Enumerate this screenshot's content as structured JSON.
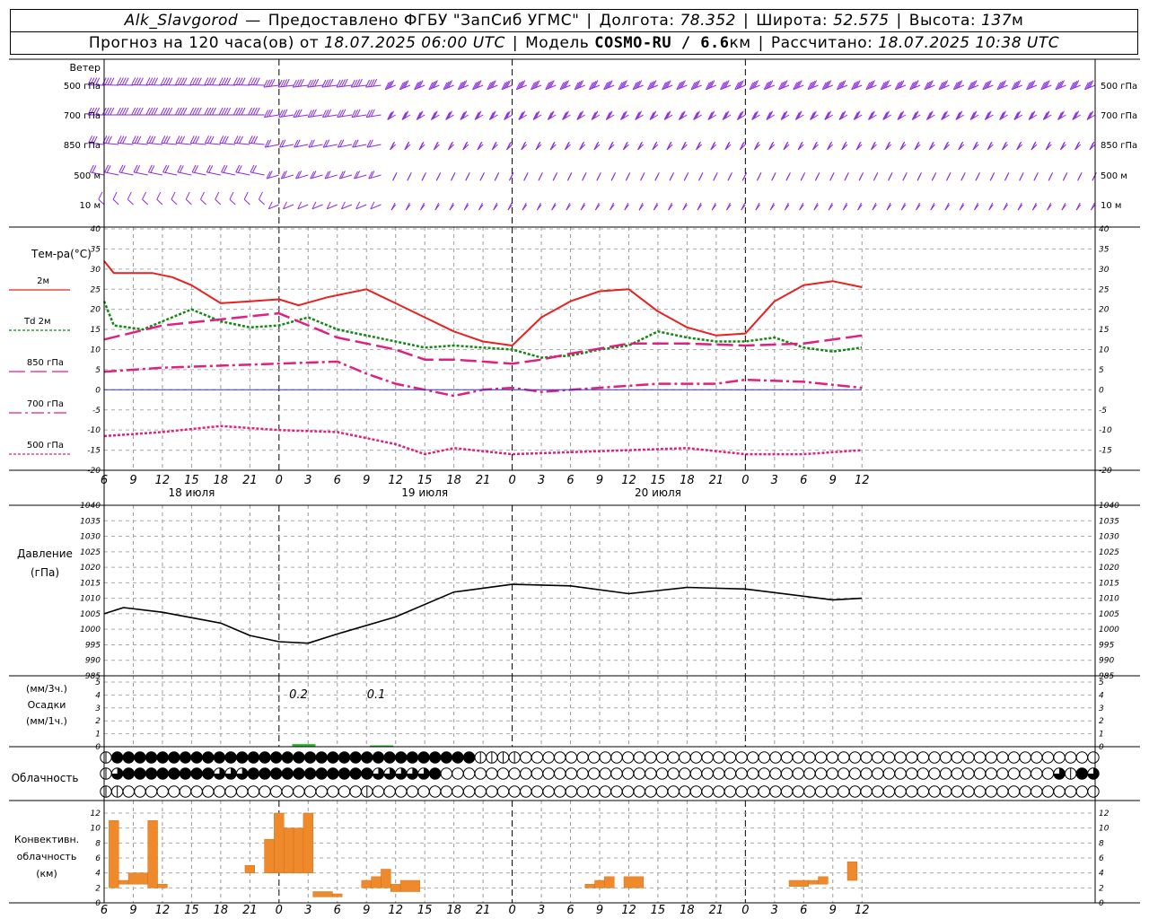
{
  "header": {
    "station": "Alk_Slavgorod",
    "provider": "Предоставлено ФГБУ \"ЗапСиб УГМС\"",
    "lon_label": "Долгота:",
    "lon": "78.352",
    "lat_label": "Широта:",
    "lat": "52.575",
    "alt_label": "Высота:",
    "alt": "137",
    "alt_unit": "м",
    "forecast_prefix": "Прогноз на 120 часа(ов) от",
    "forecast_time": "18.07.2025 06:00 UTC",
    "model_prefix": "Модель",
    "model": "COSMO-RU / 6.6",
    "model_unit": "км",
    "calc_prefix": "Рассчитано:",
    "calc_time": "18.07.2025 10:38 UTC"
  },
  "labels": {
    "wind": "Ветер",
    "wind_levels": [
      "500 гПа",
      "700 гПа",
      "850 гПа",
      "500 м",
      "10 м"
    ],
    "temp_title": "Тем-ра(°C)",
    "pressure_title": "Давление",
    "pressure_unit": "(гПа)",
    "precip_unit_top": "(мм/3ч.)",
    "precip_title": "Осадки",
    "precip_unit_bottom": "(мм/1ч.)",
    "cloud_title": "Облачность",
    "conv_title_1": "Конвективн.",
    "conv_title_2": "облачность",
    "conv_unit": "(км)"
  },
  "chart_data": {
    "type": "line",
    "time_axis": {
      "start": "18.07.2025 06:00 UTC",
      "tick_labels": [
        "6",
        "9",
        "12",
        "15",
        "18",
        "21",
        "0",
        "3",
        "6",
        "9",
        "12",
        "15",
        "18",
        "21",
        "0",
        "3",
        "6",
        "9",
        "12",
        "15",
        "18",
        "21",
        "0",
        "3",
        "6",
        "9",
        "12"
      ],
      "day_labels": [
        "18 июля",
        "19 июля",
        "20 июля"
      ]
    },
    "temperature": {
      "ylim": [
        -20,
        40
      ],
      "ticks": [
        40,
        35,
        30,
        25,
        20,
        15,
        10,
        5,
        0,
        -5,
        -10,
        -15,
        -20
      ],
      "series": [
        {
          "name": "2м",
          "color": "#e82020",
          "x": [
            "18.07 06:00",
            "18.07 07:00",
            "18.07 09:00",
            "18.07 11:00",
            "18.07 13:00",
            "18.07 15:00",
            "18.07 18:00",
            "18.07 21:00",
            "19.07 00:00",
            "19.07 02:00",
            "19.07 05:00",
            "19.07 09:00",
            "19.07 12:00",
            "19.07 15:00",
            "19.07 18:00",
            "19.07 21:00",
            "20.07 00:00",
            "20.07 03:00",
            "20.07 06:00",
            "20.07 09:00",
            "20.07 12:00",
            "20.07 15:00",
            "20.07 18:00",
            "20.07 21:00",
            "21.07 00:00",
            "21.07 03:00",
            "21.07 06:00",
            "21.07 09:00",
            "21.07 12:00"
          ],
          "y": [
            32,
            29,
            29,
            29,
            28,
            26,
            21.5,
            22,
            22.5,
            21,
            23,
            25,
            21.5,
            18,
            14.5,
            12,
            11,
            18,
            22,
            24.5,
            25,
            19.5,
            15.5,
            13.5,
            14,
            22,
            26,
            27,
            25.5
          ]
        },
        {
          "name": "Td 2м",
          "color": "#118811",
          "x": [
            "18.07 06:00",
            "18.07 07:00",
            "18.07 10:00",
            "18.07 12:00",
            "18.07 15:00",
            "18.07 18:00",
            "18.07 21:00",
            "19.07 00:00",
            "19.07 03:00",
            "19.07 06:00",
            "19.07 09:00",
            "19.07 12:00",
            "19.07 15:00",
            "19.07 18:00",
            "19.07 21:00",
            "20.07 00:00",
            "20.07 03:00",
            "20.07 06:00",
            "20.07 09:00",
            "20.07 12:00",
            "20.07 15:00",
            "20.07 18:00",
            "20.07 21:00",
            "21.07 00:00",
            "21.07 03:00",
            "21.07 06:00",
            "21.07 09:00",
            "21.07 12:00"
          ],
          "y": [
            22,
            16,
            15,
            17,
            20,
            17,
            15.5,
            16,
            18,
            15,
            13.5,
            12,
            10.5,
            11,
            10.5,
            10,
            8,
            8.5,
            10,
            11,
            14.5,
            13,
            12,
            12,
            13,
            10.5,
            9.5,
            10.5
          ]
        },
        {
          "name": "850 гПа",
          "color": "#e0207f",
          "x": [
            "18.07 06:00",
            "18.07 12:00",
            "18.07 18:00",
            "19.07 00:00",
            "19.07 06:00",
            "19.07 12:00",
            "19.07 15:00",
            "19.07 18:00",
            "19.07 21:00",
            "20.07 00:00",
            "20.07 03:00",
            "20.07 06:00",
            "20.07 12:00",
            "20.07 18:00",
            "21.07 00:00",
            "21.07 06:00",
            "21.07 12:00"
          ],
          "y": [
            12.5,
            16,
            17.5,
            19,
            13,
            10,
            7.5,
            7.5,
            7,
            6.5,
            7.5,
            9,
            11.5,
            11.5,
            11,
            11.5,
            13.5
          ]
        },
        {
          "name": "700 гПа",
          "color": "#e0207f",
          "x": [
            "18.07 06:00",
            "18.07 12:00",
            "18.07 18:00",
            "19.07 00:00",
            "19.07 06:00",
            "19.07 09:00",
            "19.07 12:00",
            "19.07 15:00",
            "19.07 18:00",
            "19.07 21:00",
            "20.07 00:00",
            "20.07 03:00",
            "20.07 09:00",
            "20.07 15:00",
            "20.07 21:00",
            "21.07 00:00",
            "21.07 06:00",
            "21.07 12:00"
          ],
          "y": [
            4.5,
            5.5,
            6,
            6.5,
            7,
            4,
            1.5,
            0,
            -1.5,
            0,
            0.5,
            -0.5,
            0.5,
            1.5,
            1.5,
            2.5,
            2,
            0.5
          ]
        },
        {
          "name": "500 гПа",
          "color": "#e0207f",
          "x": [
            "18.07 06:00",
            "18.07 12:00",
            "18.07 18:00",
            "19.07 00:00",
            "19.07 06:00",
            "19.07 12:00",
            "19.07 15:00",
            "19.07 18:00",
            "20.07 00:00",
            "20.07 06:00",
            "20.07 12:00",
            "20.07 18:00",
            "21.07 00:00",
            "21.07 06:00",
            "21.07 12:00"
          ],
          "y": [
            -11.5,
            -10.5,
            -9,
            -10,
            -10.5,
            -13.5,
            -16,
            -14.5,
            -16,
            -15.5,
            -15,
            -14.5,
            -16,
            -16,
            -15
          ]
        },
        {
          "name": "0",
          "color": "#3333dd",
          "x": [
            "18.07 06:00",
            "21.07 12:00"
          ],
          "y": [
            0,
            0
          ]
        }
      ]
    },
    "pressure": {
      "ylim": [
        985,
        1040
      ],
      "ticks": [
        1040,
        1035,
        1030,
        1025,
        1020,
        1015,
        1010,
        1005,
        1000,
        995,
        990,
        985
      ],
      "x": [
        "18.07 06:00",
        "18.07 08:00",
        "18.07 12:00",
        "18.07 18:00",
        "18.07 21:00",
        "19.07 00:00",
        "19.07 03:00",
        "19.07 06:00",
        "19.07 12:00",
        "19.07 18:00",
        "20.07 00:00",
        "20.07 06:00",
        "20.07 12:00",
        "20.07 18:00",
        "21.07 00:00",
        "21.07 09:00",
        "21.07 12:00"
      ],
      "y": [
        1005,
        1007,
        1005.5,
        1002,
        998,
        996,
        995.5,
        998.5,
        1004,
        1012,
        1014.5,
        1014,
        1011.5,
        1013.5,
        1013,
        1009.5,
        1010
      ]
    },
    "precipitation": {
      "ylim": [
        0,
        5
      ],
      "ticks": [
        5,
        4,
        3,
        2,
        1,
        0
      ],
      "bars": [
        {
          "x": "19.07 02:00",
          "value": 0.2
        },
        {
          "x": "19.07 10:00",
          "value": 0.1
        }
      ],
      "labels": [
        "0.2",
        "0.1"
      ]
    },
    "cloudiness": {
      "rows": [
        "1222222222222222222222222222222221111000000000000000000000000000000000000000000000000000",
        "1322222222333222222222223333320000000000000000000000000000000000000000000000000000003123",
        "1100000000000000000000010000000000000000000000000000000000000000000000000000000000000000"
      ]
    },
    "convective": {
      "ylim": [
        0,
        12
      ],
      "ticks": [
        12,
        10,
        8,
        6,
        4,
        2,
        0
      ],
      "bars": [
        {
          "x": "18.07 07:00",
          "w": 1,
          "bottom": 2,
          "top": 11
        },
        {
          "x": "18.07 08:00",
          "w": 1,
          "bottom": 2.5,
          "top": 3
        },
        {
          "x": "18.07 09:00",
          "w": 2,
          "bottom": 2.5,
          "top": 4
        },
        {
          "x": "18.07 11:00",
          "w": 1,
          "bottom": 2,
          "top": 11
        },
        {
          "x": "18.07 12:00",
          "w": 1,
          "bottom": 2,
          "top": 2.5
        },
        {
          "x": "18.07 21:00",
          "w": 1,
          "bottom": 4,
          "top": 5
        },
        {
          "x": "18.07 23:00",
          "w": 1,
          "bottom": 4,
          "top": 8.5
        },
        {
          "x": "19.07 00:00",
          "w": 1,
          "bottom": 4,
          "top": 12
        },
        {
          "x": "19.07 01:00",
          "w": 1,
          "bottom": 4,
          "top": 10
        },
        {
          "x": "19.07 02:00",
          "w": 1,
          "bottom": 4,
          "top": 10
        },
        {
          "x": "19.07 03:00",
          "w": 1,
          "bottom": 4,
          "top": 12
        },
        {
          "x": "19.07 04:00",
          "w": 2,
          "bottom": 0.8,
          "top": 1.5
        },
        {
          "x": "19.07 06:00",
          "w": 1,
          "bottom": 0.8,
          "top": 1.2
        },
        {
          "x": "19.07 09:00",
          "w": 1,
          "bottom": 2,
          "top": 3
        },
        {
          "x": "19.07 10:00",
          "w": 1,
          "bottom": 2,
          "top": 3.5
        },
        {
          "x": "19.07 11:00",
          "w": 1,
          "bottom": 2,
          "top": 4.5
        },
        {
          "x": "19.07 12:00",
          "w": 1,
          "bottom": 1.5,
          "top": 2.5
        },
        {
          "x": "19.07 13:00",
          "w": 2,
          "bottom": 1.5,
          "top": 3
        },
        {
          "x": "20.07 08:00",
          "w": 1,
          "bottom": 2,
          "top": 2.5
        },
        {
          "x": "20.07 09:00",
          "w": 1,
          "bottom": 2,
          "top": 3
        },
        {
          "x": "20.07 10:00",
          "w": 1,
          "bottom": 2,
          "top": 3.5
        },
        {
          "x": "20.07 12:00",
          "w": 2,
          "bottom": 2,
          "top": 3.5
        },
        {
          "x": "21.07 05:00",
          "w": 2,
          "bottom": 2.2,
          "top": 3
        },
        {
          "x": "21.07 07:00",
          "w": 1,
          "bottom": 2.5,
          "top": 3
        },
        {
          "x": "21.07 08:00",
          "w": 1,
          "bottom": 2.5,
          "top": 3.5
        },
        {
          "x": "21.07 11:00",
          "w": 1,
          "bottom": 3,
          "top": 5.5
        }
      ]
    },
    "wind_barbs": {
      "unit": "schematic",
      "levels": [
        "500 гПа",
        "700 гПа",
        "850 гПа",
        "500 м",
        "10 м"
      ],
      "segments": [
        {
          "x_from": "18.07 06:00",
          "x_to": "19.07 00:00",
          "levels": {
            "500 гПа": {
              "deg": 265,
              "speed": 40
            },
            "700 гПа": {
              "deg": 270,
              "speed": 35
            },
            "850 гПа": {
              "deg": 255,
              "speed": 25
            },
            "500 м": {
              "deg": 240,
              "speed": 20
            },
            "10 м": {
              "deg": 200,
              "speed": 10
            }
          }
        },
        {
          "x_from": "19.07 00:00",
          "x_to": "19.07 12:00",
          "levels": {
            "500 гПа": {
              "deg": 290,
              "speed": 40
            },
            "700 гПа": {
              "deg": 295,
              "speed": 30
            },
            "850 гПа": {
              "deg": 300,
              "speed": 20
            },
            "500 м": {
              "deg": 310,
              "speed": 15
            },
            "10 м": {
              "deg": 320,
              "speed": 10
            }
          }
        },
        {
          "x_from": "19.07 12:00",
          "x_to": "21.07 12:00",
          "levels": {
            "500 гПа": {
              "deg": 320,
              "speed": 35
            },
            "700 гПа": {
              "deg": 330,
              "speed": 30
            },
            "850 гПа": {
              "deg": 340,
              "speed": 20
            },
            "500 м": {
              "deg": 350,
              "speed": 15
            },
            "10 м": {
              "deg": 345,
              "speed": 10
            }
          }
        }
      ]
    }
  }
}
